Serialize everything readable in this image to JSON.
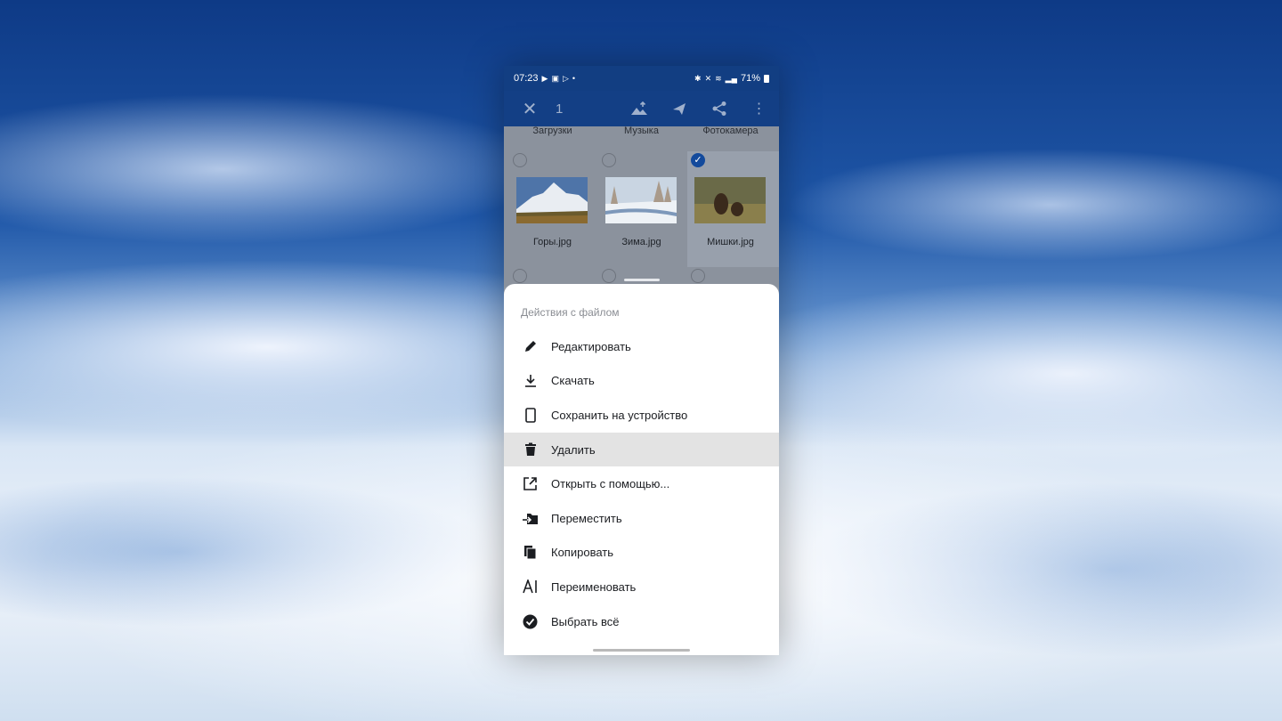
{
  "status": {
    "time": "07:23",
    "battery": "71%"
  },
  "toolbar": {
    "selected_count": "1"
  },
  "folders": [
    "Загрузки",
    "Музыка",
    "Фотокамера"
  ],
  "files": [
    {
      "name": "Горы.jpg",
      "selected": false
    },
    {
      "name": "Зима.jpg",
      "selected": false
    },
    {
      "name": "Мишки.jpg",
      "selected": true
    }
  ],
  "sheet": {
    "title": "Действия с файлом",
    "items": [
      {
        "label": "Редактировать",
        "icon": "pencil-icon"
      },
      {
        "label": "Скачать",
        "icon": "download-icon"
      },
      {
        "label": "Сохранить на устройство",
        "icon": "phone-icon"
      },
      {
        "label": "Удалить",
        "icon": "trash-icon"
      },
      {
        "label": "Открыть с помощью...",
        "icon": "open-external-icon"
      },
      {
        "label": "Переместить",
        "icon": "move-icon"
      },
      {
        "label": "Копировать",
        "icon": "copy-icon"
      },
      {
        "label": "Переименовать",
        "icon": "rename-icon"
      },
      {
        "label": "Выбрать всё",
        "icon": "check-circle-icon"
      }
    ]
  },
  "colors": {
    "appbar": "#133f85",
    "accent": "#134a9c",
    "highlight": "#e3e3e3"
  }
}
